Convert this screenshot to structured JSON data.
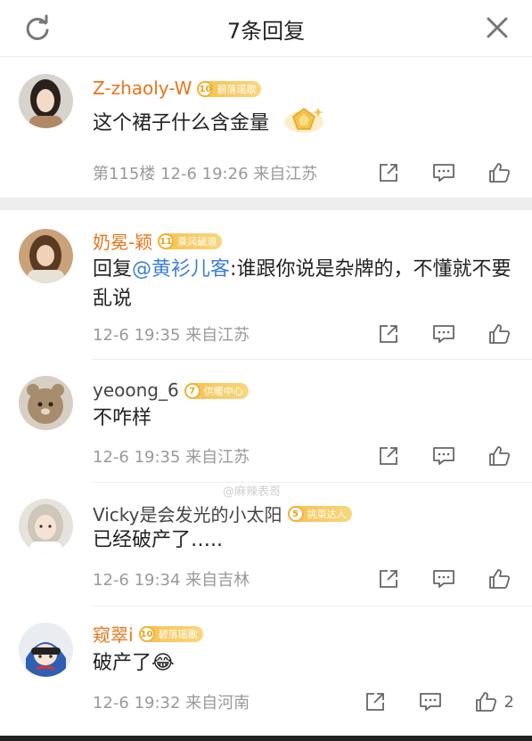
{
  "header": {
    "title": "7条回复"
  },
  "comments": [
    {
      "username": "Z-zhaoly-W",
      "badge_level": "10",
      "badge_text": "碧落瑶歌",
      "text": "这个裙子什么含金量",
      "meta": "第115楼  12-6 19:26  来自江苏"
    },
    {
      "username": "奶冕-颖",
      "badge_level": "11",
      "badge_text": "乘风破浪",
      "text_prefix": "回复",
      "mention": "@黄衫儿客",
      "text": ":谁跟你说是杂牌的，不懂就不要乱说",
      "meta": "12-6 19:35  来自江苏"
    },
    {
      "username": "yeoong_6",
      "badge_level": "7",
      "badge_text": "供暖中心",
      "text": "不咋样",
      "meta": "12-6 19:35  来自江苏"
    },
    {
      "username": "Vicky是会发光的小太阳",
      "badge_level": "5",
      "badge_text": "挑菜达人",
      "text": "已经破产了…..",
      "meta": "12-6 19:34  来自吉林"
    },
    {
      "username": "窥翠i",
      "badge_level": "10",
      "badge_text": "碧落瑶歌",
      "text": "破产了😂",
      "meta": "12-6 19:32  来自河南",
      "likes": "2"
    }
  ],
  "watermark": "@麻辣表哥",
  "colors": {
    "vip_name": "#e8761b",
    "mention": "#3b7fd4",
    "meta": "#999999",
    "badge": "#f6c04e"
  }
}
